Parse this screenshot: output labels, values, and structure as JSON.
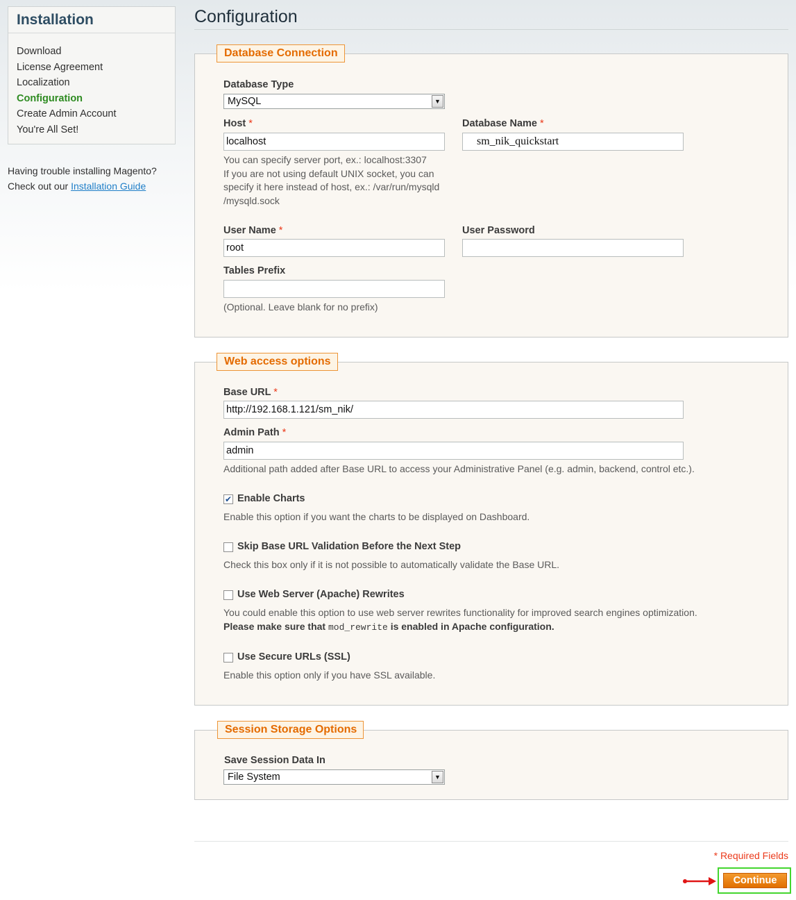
{
  "sidebar": {
    "title": "Installation",
    "items": [
      {
        "label": "Download",
        "active": false
      },
      {
        "label": "License Agreement",
        "active": false
      },
      {
        "label": "Localization",
        "active": false
      },
      {
        "label": "Configuration",
        "active": true
      },
      {
        "label": "Create Admin Account",
        "active": false
      },
      {
        "label": "You're All Set!",
        "active": false
      }
    ],
    "help_line1": "Having trouble installing Magento?",
    "help_prefix": "Check out our ",
    "help_link": "Installation Guide"
  },
  "page_title": "Configuration",
  "db": {
    "legend": "Database Connection",
    "type_label": "Database Type",
    "type_value": "MySQL",
    "host_label": "Host",
    "host_value": "localhost",
    "host_note1": "You can specify server port, ex.: localhost:3307",
    "host_note2": "If you are not using default UNIX socket, you can",
    "host_note3": "specify it here instead of host, ex.: /var/run/mysqld",
    "host_note4": "/mysqld.sock",
    "name_label": "Database Name",
    "name_value": "sm_nik_quickstart",
    "user_label": "User Name",
    "user_value": "root",
    "password_label": "User Password",
    "password_value": "",
    "prefix_label": "Tables Prefix",
    "prefix_value": "",
    "prefix_note": "(Optional. Leave blank for no prefix)"
  },
  "web": {
    "legend": "Web access options",
    "base_url_label": "Base URL",
    "base_url_value": "http://192.168.1.121/sm_nik/",
    "admin_path_label": "Admin Path",
    "admin_path_value": "admin",
    "admin_path_note": "Additional path added after Base URL to access your Administrative Panel (e.g. admin, backend, control etc.).",
    "enable_charts_label": "Enable Charts",
    "enable_charts_note": "Enable this option if you want the charts to be displayed on Dashboard.",
    "skip_label": "Skip Base URL Validation Before the Next Step",
    "skip_note": "Check this box only if it is not possible to automatically validate the Base URL.",
    "rewrites_label": "Use Web Server (Apache) Rewrites",
    "rewrites_note": "You could enable this option to use web server rewrites functionality for improved search engines optimization.",
    "rewrites_note2_prefix": "Please make sure that ",
    "rewrites_note2_code": "mod_rewrite",
    "rewrites_note2_suffix": " is enabled in Apache configuration.",
    "ssl_label": "Use Secure URLs (SSL)",
    "ssl_note": "Enable this option only if you have SSL available."
  },
  "session": {
    "legend": "Session Storage Options",
    "save_label": "Save Session Data In",
    "save_value": "File System"
  },
  "required_asterisk": "*",
  "required_fields": "* Required Fields",
  "continue_label": "Continue",
  "colors": {
    "accent": "#e46b00",
    "link": "#1e7ec8",
    "active": "#2e8b21",
    "required": "#eb3a1b",
    "highlight": "#43d62e"
  }
}
